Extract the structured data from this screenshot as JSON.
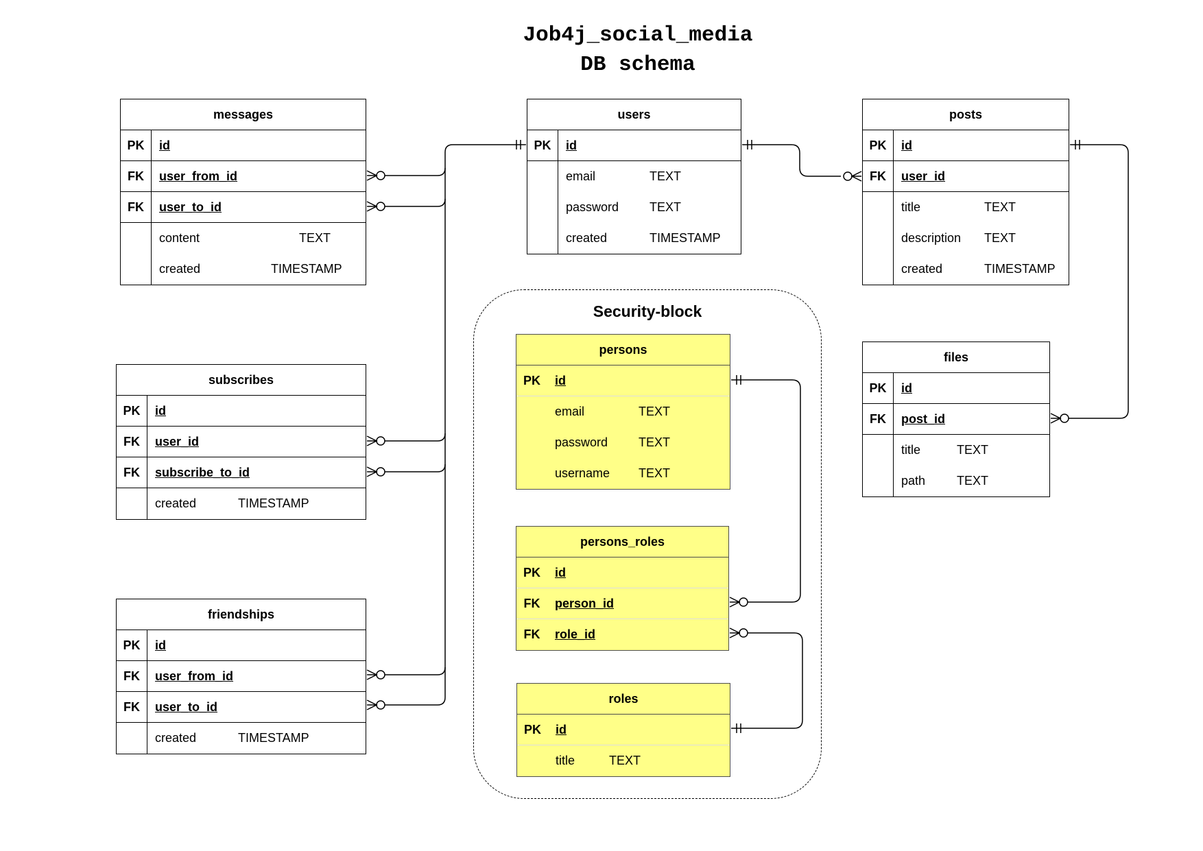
{
  "title": {
    "line1": "Job4j_social_media",
    "line2": "DB schema"
  },
  "security_block": {
    "label": "Security-block"
  },
  "tables": {
    "messages": {
      "name": "messages",
      "rows": [
        {
          "key": "PK",
          "name": "id",
          "type": ""
        },
        {
          "key": "FK",
          "name": "user_from_id",
          "type": ""
        },
        {
          "key": "FK",
          "name": "user_to_id",
          "type": ""
        },
        {
          "key": "",
          "name": "content",
          "type": "TEXT"
        },
        {
          "key": "",
          "name": "created",
          "type": "TIMESTAMP"
        }
      ]
    },
    "users": {
      "name": "users",
      "rows": [
        {
          "key": "PK",
          "name": "id",
          "type": ""
        },
        {
          "key": "",
          "name": "email",
          "type": "TEXT"
        },
        {
          "key": "",
          "name": "password",
          "type": "TEXT"
        },
        {
          "key": "",
          "name": "created",
          "type": "TIMESTAMP"
        }
      ]
    },
    "posts": {
      "name": "posts",
      "rows": [
        {
          "key": "PK",
          "name": "id",
          "type": ""
        },
        {
          "key": "FK",
          "name": "user_id",
          "type": ""
        },
        {
          "key": "",
          "name": "title",
          "type": "TEXT"
        },
        {
          "key": "",
          "name": "description",
          "type": "TEXT"
        },
        {
          "key": "",
          "name": "created",
          "type": "TIMESTAMP"
        }
      ]
    },
    "subscribes": {
      "name": "subscribes",
      "rows": [
        {
          "key": "PK",
          "name": "id",
          "type": ""
        },
        {
          "key": "FK",
          "name": "user_id",
          "type": ""
        },
        {
          "key": "FK",
          "name": "subscribe_to_id",
          "type": ""
        },
        {
          "key": "",
          "name": "created",
          "type": "TIMESTAMP"
        }
      ]
    },
    "friendships": {
      "name": "friendships",
      "rows": [
        {
          "key": "PK",
          "name": "id",
          "type": ""
        },
        {
          "key": "FK",
          "name": "user_from_id",
          "type": ""
        },
        {
          "key": "FK",
          "name": "user_to_id",
          "type": ""
        },
        {
          "key": "",
          "name": "created",
          "type": "TIMESTAMP"
        }
      ]
    },
    "files": {
      "name": "files",
      "rows": [
        {
          "key": "PK",
          "name": "id",
          "type": ""
        },
        {
          "key": "FK",
          "name": "post_id",
          "type": ""
        },
        {
          "key": "",
          "name": "title",
          "type": "TEXT"
        },
        {
          "key": "",
          "name": "path",
          "type": "TEXT"
        }
      ]
    },
    "persons": {
      "name": "persons",
      "rows": [
        {
          "key": "PK",
          "name": "id",
          "type": ""
        },
        {
          "key": "",
          "name": "email",
          "type": "TEXT"
        },
        {
          "key": "",
          "name": "password",
          "type": "TEXT"
        },
        {
          "key": "",
          "name": "username",
          "type": "TEXT"
        }
      ]
    },
    "persons_roles": {
      "name": "persons_roles",
      "rows": [
        {
          "key": "PK",
          "name": "id",
          "type": ""
        },
        {
          "key": "FK",
          "name": "person_id",
          "type": ""
        },
        {
          "key": "FK",
          "name": "role_id",
          "type": ""
        }
      ]
    },
    "roles": {
      "name": "roles",
      "rows": [
        {
          "key": "PK",
          "name": "id",
          "type": ""
        },
        {
          "key": "",
          "name": "title",
          "type": "TEXT"
        }
      ]
    }
  }
}
